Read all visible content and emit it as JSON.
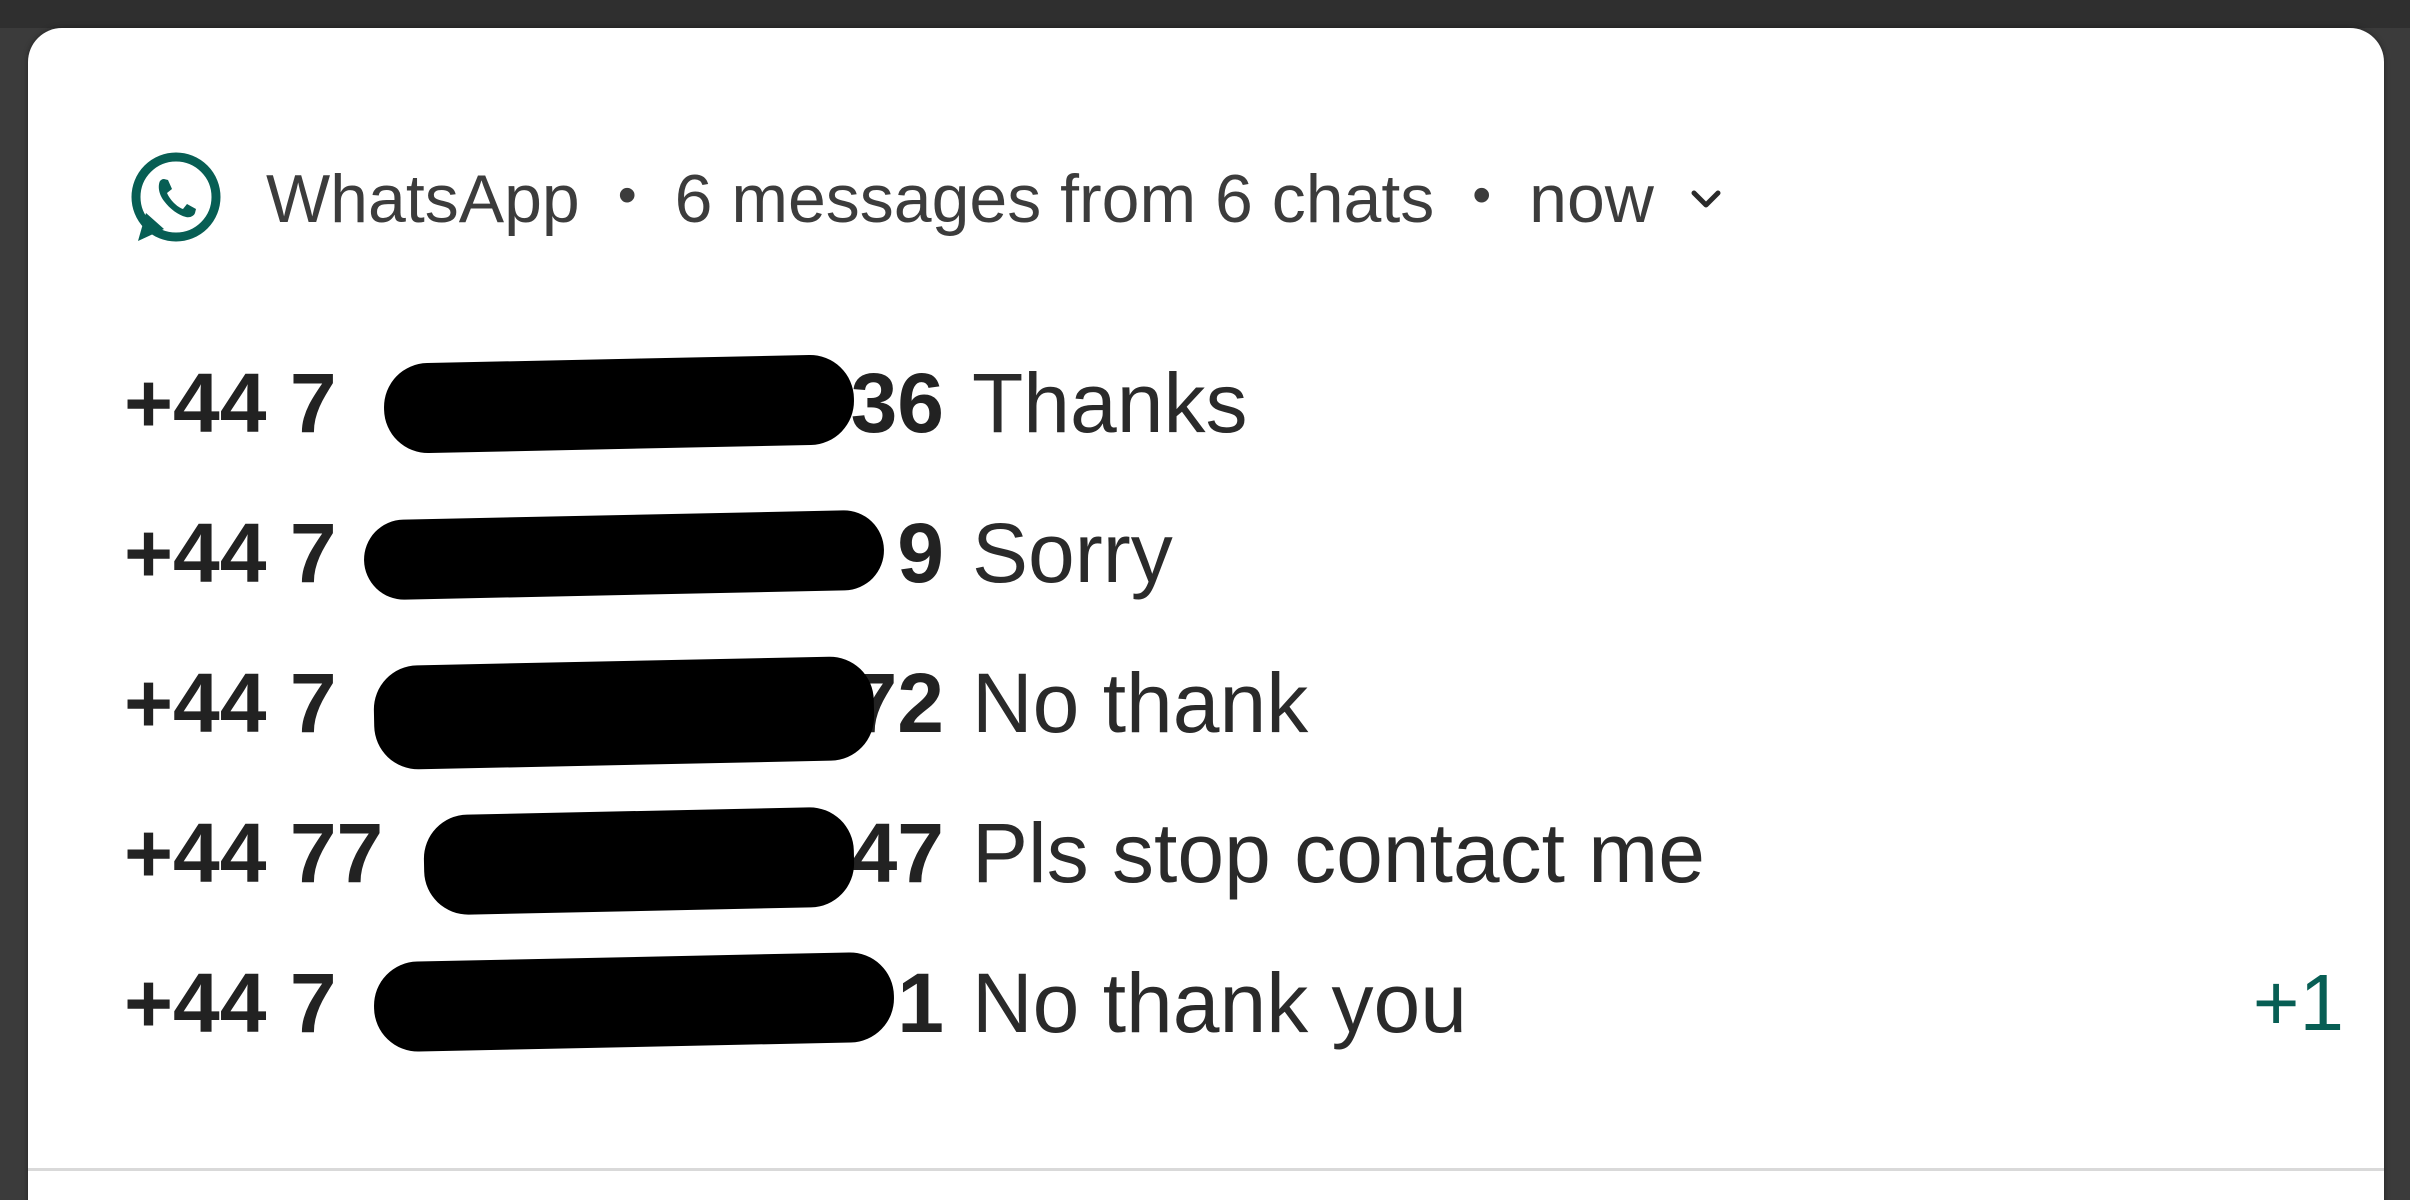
{
  "notification": {
    "app_name": "WhatsApp",
    "summary": "6 messages from 6 chats",
    "time": "now",
    "separator": "•",
    "icon": "whatsapp-icon",
    "expand_icon": "chevron-down-icon",
    "accent_color": "#075e54"
  },
  "messages": [
    {
      "sender_prefix": "+44 7",
      "sender_suffix": "36",
      "text": "Thanks"
    },
    {
      "sender_prefix": "+44 7",
      "sender_suffix": "9",
      "text": "Sorry"
    },
    {
      "sender_prefix": "+44 7",
      "sender_suffix": "72",
      "text": "No thank"
    },
    {
      "sender_prefix": "+44 77",
      "sender_suffix": "47",
      "text": "Pls stop contact me"
    },
    {
      "sender_prefix": "+44 7",
      "sender_suffix": "1",
      "text": "No thank you"
    }
  ],
  "more_count": "+1"
}
